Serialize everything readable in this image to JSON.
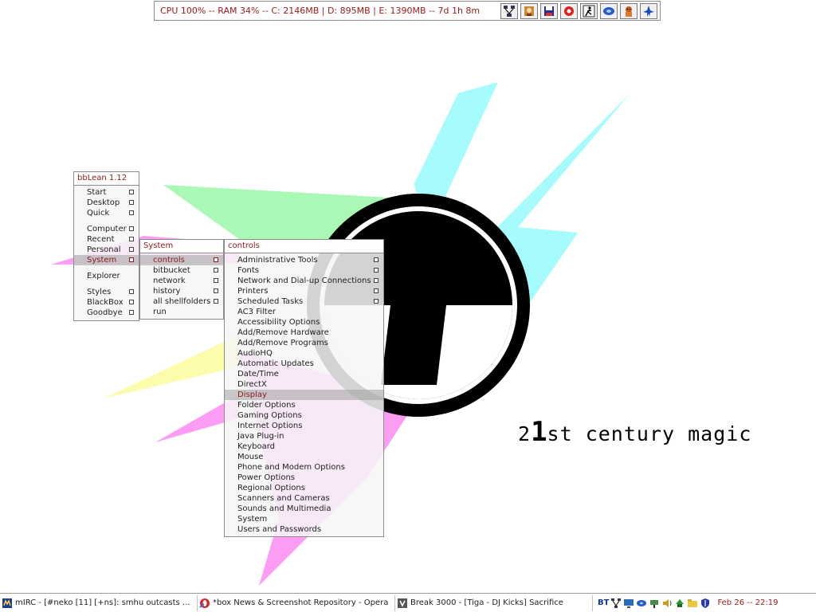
{
  "sysbar": {
    "stats": "CPU 100% -- RAM 34% -- C: 2146MB | D: 895MB | E: 1390MB -- 7d 1h 8m",
    "tray_icons": [
      "network-icon",
      "character-icon",
      "save-icon",
      "media-icon",
      "runner-icon",
      "disc-icon",
      "bear-icon",
      "jet-icon"
    ]
  },
  "wallpaper": {
    "motto_prefix": "2",
    "motto_big": "1",
    "motto_rest": "st century magic",
    "colors": {
      "cyan": "#a6fcfc",
      "green": "#aaf8b6",
      "pink": "#fc9cf2",
      "yellow": "#fcfcac",
      "black": "#000000"
    }
  },
  "menus": {
    "root": {
      "title": "bbLean 1.12",
      "items": [
        "Start",
        "Desktop",
        "Quick",
        "Computer",
        "Recent",
        "Personal",
        "System",
        "Explorer",
        "Styles",
        "BlackBox",
        "Goodbye"
      ]
    },
    "system": {
      "title": "System",
      "items": [
        "controls",
        "bitbucket",
        "network",
        "history",
        "all shellfolders",
        "run"
      ]
    },
    "controls": {
      "title": "controls",
      "items": [
        "Administrative Tools",
        "Fonts",
        "Network and Dial-up Connections",
        "Printers",
        "Scheduled Tasks",
        "AC3 Filter",
        "Accessibility Options",
        "Add/Remove Hardware",
        "Add/Remove Programs",
        "AudioHQ",
        "Automatic Updates",
        "Date/Time",
        "DirectX",
        "Display",
        "Folder Options",
        "Gaming Options",
        "Internet Options",
        "Java Plug-in",
        "Keyboard",
        "Mouse",
        "Phone and Modem Options",
        "Power Options",
        "Regional Options",
        "Scanners and Cameras",
        "Sounds and Multimedia",
        "System",
        "Users and Passwords"
      ]
    }
  },
  "taskbar": {
    "tasks": [
      {
        "label": "mIRC - [#neko [11] [+ns]: smhu outcasts ...",
        "icon": "mirc-icon"
      },
      {
        "label": "*box News & Screenshot Repository - Opera",
        "icon": "opera-icon"
      },
      {
        "label": "Break 3000 - [Tiga - DJ Kicks] Sacrifice",
        "icon": "player-icon"
      }
    ],
    "tray_label": "BT",
    "tray_icons": [
      "network-icon",
      "monitor-icon",
      "disc-icon",
      "network-cable-icon",
      "volume-icon",
      "recycle-icon",
      "folder-icon",
      "shield-icon"
    ],
    "clock": "Feb 26 -- 22:19"
  }
}
